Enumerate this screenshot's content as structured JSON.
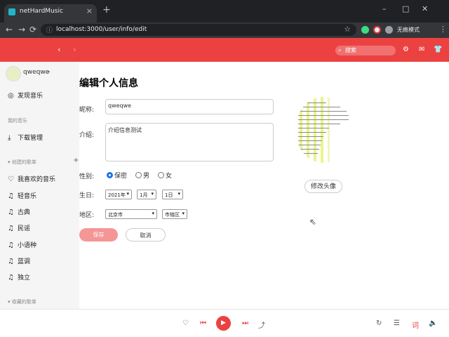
{
  "browser": {
    "tab_title": "netHardMusic",
    "tab_close": "×",
    "new_tab": "+",
    "url": "localhost:3000/user/info/edit",
    "profile_label": "无痕模式",
    "win_min": "–",
    "win_max": "□",
    "win_close": "✕",
    "back": "←",
    "forward": "→",
    "reload": "⟳",
    "lock": "ⓘ",
    "star": "☆",
    "menu": "⋮"
  },
  "appbar": {
    "back": "‹",
    "forward": "›",
    "search_placeholder": "搜索",
    "search_icon": "search-icon",
    "settings_icon": "⚙",
    "mail_icon": "✉",
    "skin_icon": "👕",
    "accent_color": "#ec4141"
  },
  "sidebar": {
    "username": "qweqwe",
    "caret": "▸",
    "discover": "发现音乐",
    "section_my_music": "我的音乐",
    "downloads": "下载管理",
    "section_created": "▾ 创建的歌单",
    "add": "+",
    "playlists": [
      {
        "label": "我喜欢的音乐",
        "icon": "♡"
      },
      {
        "label": "轻音乐",
        "icon": "♫"
      },
      {
        "label": "古典",
        "icon": "♫"
      },
      {
        "label": "民谣",
        "icon": "♫"
      },
      {
        "label": "小语种",
        "icon": "♫"
      },
      {
        "label": "蓝调",
        "icon": "♫"
      },
      {
        "label": "独立",
        "icon": "♫"
      }
    ],
    "section_collected": "▾ 收藏的歌单"
  },
  "form": {
    "title": "编辑个人信息",
    "nickname_label": "昵称:",
    "nickname_value": "qweqwe",
    "intro_label": "介绍:",
    "intro_value": "介绍信息测试",
    "gender_label": "性别:",
    "gender_options": [
      "保密",
      "男",
      "女"
    ],
    "gender_selected": "保密",
    "birthday_label": "生日:",
    "year": "2021年",
    "month": "1月",
    "day": "1日",
    "region_label": "地区:",
    "province": "北京市",
    "district": "市辖区",
    "save": "保存",
    "cancel": "取消",
    "change_avatar": "修改头像"
  },
  "player": {
    "like": "♡",
    "prev": "⏮",
    "play": "▶",
    "next": "⏭",
    "share": "⤴",
    "loop": "↻",
    "list": "☰",
    "lyrics": "词",
    "volume": "🔈"
  }
}
